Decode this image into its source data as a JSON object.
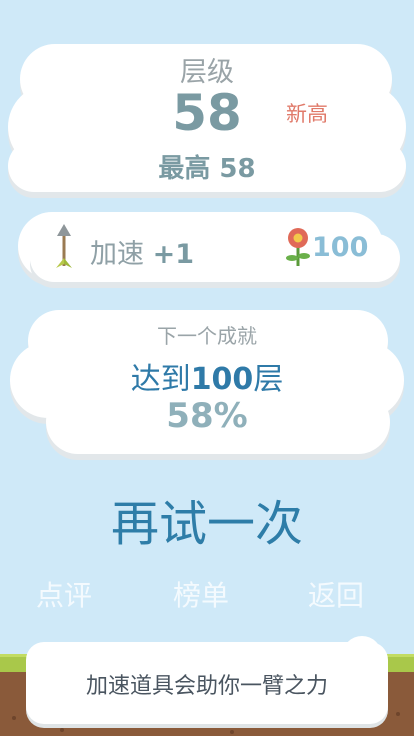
{
  "level": {
    "label": "层级",
    "value": "58",
    "new_badge": "新高",
    "best": "最高 58"
  },
  "bonus": {
    "item_name": "加速",
    "item_bonus": "+1",
    "flower_count": "100"
  },
  "achievement": {
    "title": "下一个成就",
    "goal_prefix": "达到",
    "goal_number": "100",
    "goal_suffix": "层",
    "progress": "58%"
  },
  "retry_label": "再试一次",
  "nav": {
    "review": "点评",
    "rank": "榜单",
    "back": "返回"
  },
  "tip": "加速道具会助你一臂之力",
  "colors": {
    "sky": "#cfe9f8",
    "accent": "#2e7da8",
    "new_high": "#e07a6a"
  }
}
